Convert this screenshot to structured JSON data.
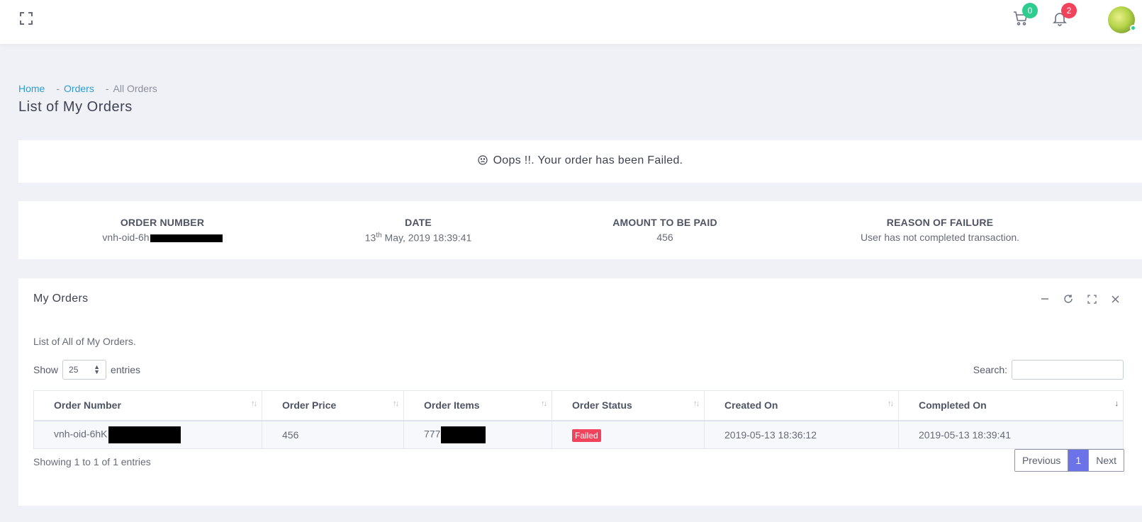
{
  "topbar": {
    "cart_count": "0",
    "notification_count": "2",
    "colors": {
      "cart_badge": "#2ecc8f",
      "notif_badge": "#f1435b",
      "avatar_status": "#2ecc8f"
    }
  },
  "breadcrumb": {
    "home": "Home",
    "orders": "Orders",
    "current": "All Orders",
    "separator": "-"
  },
  "page_title": "List of My Orders",
  "alert": {
    "icon": "sad-face-icon",
    "message": "Oops !!. Your order has been Failed."
  },
  "summary": {
    "order_number_label": "ORDER NUMBER",
    "order_number_value": "vnh-oid-6h",
    "date_label": "DATE",
    "date_day": "13",
    "date_suffix": "th",
    "date_rest": " May, 2019 18:39:41",
    "amount_label": "AMOUNT TO BE PAID",
    "amount_value": "456",
    "reason_label": "REASON OF FAILURE",
    "reason_value": "User has not completed transaction."
  },
  "orders_card": {
    "title": "My Orders",
    "description": "List of All of My Orders.",
    "show_label": "Show",
    "entries_value": "25",
    "entries_label": "entries",
    "search_label": "Search:",
    "columns": [
      "Order Number",
      "Order Price",
      "Order Items",
      "Order Status",
      "Created On",
      "Completed On"
    ],
    "rows": [
      {
        "order_number": "vnh-oid-6hK",
        "price": "456",
        "items": "777",
        "status": "Failed",
        "created_on": "2019-05-13 18:36:12",
        "completed_on": "2019-05-13 18:39:41"
      }
    ],
    "showing_text": "Showing 1 to 1 of 1 entries",
    "pagination": {
      "previous": "Previous",
      "current_page": "1",
      "next": "Next"
    }
  }
}
